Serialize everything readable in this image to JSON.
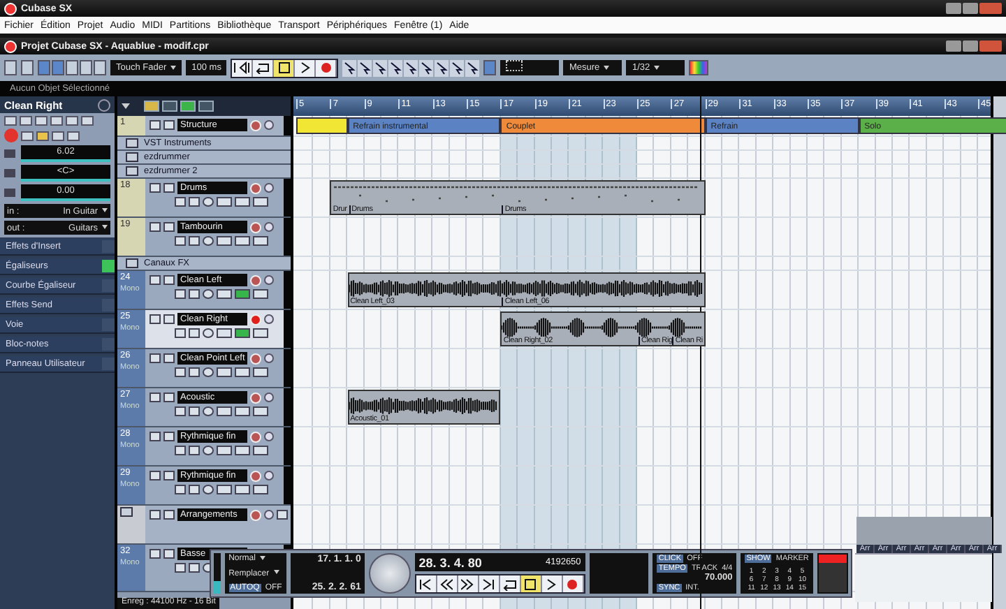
{
  "app_title": "Cubase SX",
  "menu": [
    "Fichier",
    "Édition",
    "Projet",
    "Audio",
    "MIDI",
    "Partitions",
    "Bibliothèque",
    "Transport",
    "Périphériques",
    "Fenêtre (1)",
    "Aide"
  ],
  "project_title": "Projet Cubase SX - Aquablue - modif.cpr",
  "toolbar": {
    "automation_mode": "Touch Fader",
    "time": "100 ms",
    "grid": "Mesure",
    "quantize": "1/32"
  },
  "info_line": "Aucun Objet Sélectionné",
  "inspector": {
    "track_name": "Clean Right",
    "volume": "6.02",
    "pan": "<C>",
    "delay": "0.00",
    "input_label": "in :",
    "input": "In Guitar",
    "output_label": "out :",
    "output": "Guitars",
    "sections": [
      {
        "label": "Effets d'Insert",
        "active": false
      },
      {
        "label": "Égaliseurs",
        "active": true
      },
      {
        "label": "Courbe Égaliseur",
        "active": false
      },
      {
        "label": "Effets Send",
        "active": false
      },
      {
        "label": "Voie",
        "active": false
      },
      {
        "label": "Bloc-notes",
        "active": false
      },
      {
        "label": "Panneau Utilisateur",
        "active": false
      }
    ]
  },
  "ruler": [
    "5",
    "7",
    "9",
    "11",
    "13",
    "15",
    "17",
    "19",
    "21",
    "23",
    "25",
    "27",
    "29",
    "31",
    "33",
    "35",
    "37",
    "39",
    "41",
    "43",
    "45"
  ],
  "markers": [
    {
      "color": "#f2e634"
    },
    {
      "label": "Refrain instrumental",
      "color": "#5b82c2"
    },
    {
      "label": "Couplet",
      "color": "#ee8a3a"
    },
    {
      "label": "Refrain",
      "color": "#5b82c2"
    },
    {
      "label": "Solo",
      "color": "#5cb04a"
    }
  ],
  "tracks": [
    {
      "kind": "structure",
      "number": "1",
      "name": "Structure"
    },
    {
      "kind": "folder",
      "name": "VST Instruments"
    },
    {
      "kind": "folder",
      "name": "ezdrummer"
    },
    {
      "kind": "folder",
      "name": "ezdrummer 2"
    },
    {
      "kind": "midi",
      "number": "18",
      "name": "Drums",
      "selected": false,
      "clips": [
        {
          "kind": "midi",
          "parts": [
            {
              "label": "Drur"
            },
            {
              "label": "Drums"
            },
            {
              "label": "Drums"
            }
          ]
        }
      ]
    },
    {
      "kind": "midi",
      "number": "19",
      "name": "Tambourin",
      "selected": false
    },
    {
      "kind": "folder",
      "name": "Canaux FX"
    },
    {
      "kind": "audio",
      "number": "24",
      "name": "Clean Left",
      "mode": "Mono",
      "selected": false,
      "record": false,
      "monitor": true,
      "clips": [
        {
          "kind": "audio",
          "parts": [
            {
              "label": "Clean Left_03"
            },
            {
              "label": "Clean Left_06"
            }
          ]
        }
      ]
    },
    {
      "kind": "audio",
      "number": "25",
      "name": "Clean Right",
      "mode": "Mono",
      "selected": true,
      "record": true,
      "monitor": true,
      "clips": [
        {
          "kind": "pulse",
          "parts": [
            {
              "label": "Clean Right_02"
            },
            {
              "label": "Clean Rig"
            },
            {
              "label": "Clean Ri"
            }
          ]
        }
      ]
    },
    {
      "kind": "audio",
      "number": "26",
      "name": "Clean Point Left",
      "mode": "Mono",
      "selected": false,
      "record": false,
      "monitor": false
    },
    {
      "kind": "audio",
      "number": "27",
      "name": "Acoustic",
      "mode": "Mono",
      "selected": false,
      "record": false,
      "monitor": false,
      "clips": [
        {
          "kind": "audio",
          "parts": [
            {
              "label": "Acoustic_01"
            }
          ]
        }
      ]
    },
    {
      "kind": "audio",
      "number": "28",
      "name": "Rythmique fin",
      "mode": "Mono",
      "selected": false,
      "record": false,
      "monitor": false
    },
    {
      "kind": "audio",
      "number": "29",
      "name": "Rythmique fin",
      "mode": "Mono",
      "selected": false,
      "record": false,
      "monitor": false
    },
    {
      "kind": "arranger",
      "name": "Arrangements"
    },
    {
      "kind": "audio",
      "number": "32",
      "name": "Basse",
      "mode": "Mono",
      "selected": false
    }
  ],
  "transport": {
    "record_mode": "Normal",
    "cycle_mode": "Remplacer",
    "autoq": "AUTOQ",
    "autoq_state": "OFF",
    "left_locator": "17. 1. 1. 0",
    "right_locator": "25. 2. 2. 61",
    "position": "28. 3. 4. 80",
    "samples": "4192650",
    "click": "CLICK",
    "click_state": "OFF",
    "tempo": "TEMPO",
    "tempo_mode": "TRACK",
    "signature": "4/4",
    "tempo_value": "70.000",
    "sync": "SYNC",
    "sync_state": "INT.",
    "show": "SHOW",
    "marker": "MARKER",
    "marker_keys": [
      "1",
      "2",
      "3",
      "4",
      "5",
      "6",
      "7",
      "8",
      "9",
      "10",
      "11",
      "12",
      "13",
      "14",
      "15"
    ],
    "level": 0.3
  },
  "status_bar": "Enreg : 44100 Hz - 16 Bit",
  "mini_mixer": [
    "Arr",
    "Arr",
    "Arr",
    "Arr",
    "Arr",
    "Arr",
    "Arr",
    "Arr"
  ]
}
